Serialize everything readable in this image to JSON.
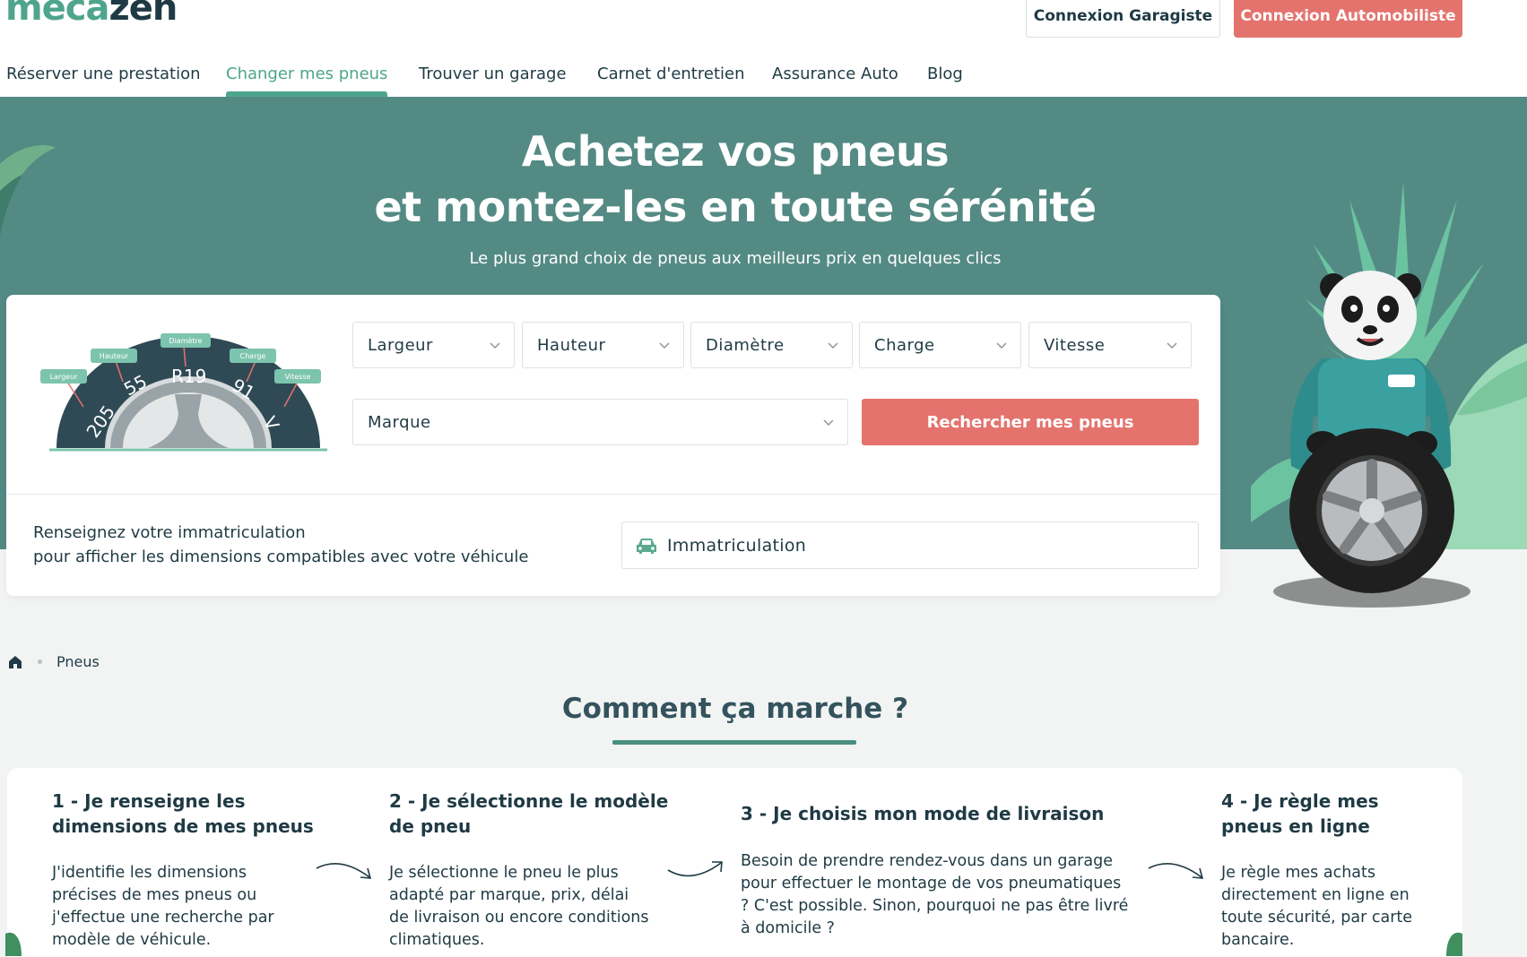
{
  "header": {
    "logo_part1": "meca",
    "logo_part2": "zen",
    "btn_garagiste": "Connexion Garagiste",
    "btn_automobiliste": "Connexion Automobiliste",
    "nav": [
      {
        "label": "Réserver une prestation",
        "active": false
      },
      {
        "label": "Changer mes pneus",
        "active": true
      },
      {
        "label": "Trouver un garage",
        "active": false
      },
      {
        "label": "Carnet d'entretien",
        "active": false
      },
      {
        "label": "Assurance Auto",
        "active": false
      },
      {
        "label": "Blog",
        "active": false
      }
    ]
  },
  "hero": {
    "title_line1": "Achetez vos pneus",
    "title_line2": "et montez-les en toute sérénité",
    "subtitle": "Le plus grand choix de pneus aux meilleurs prix en quelques clics"
  },
  "tire_diagram": {
    "labels": {
      "largeur": "Largeur",
      "hauteur": "Hauteur",
      "diametre": "Diamètre",
      "charge": "Charge",
      "vitesse": "Vitesse"
    },
    "values": {
      "largeur": "205",
      "hauteur": "55",
      "diametre": "R19",
      "charge": "91",
      "vitesse": "V"
    }
  },
  "search": {
    "selects": [
      "Largeur",
      "Hauteur",
      "Diamètre",
      "Charge",
      "Vitesse"
    ],
    "brand_select": "Marque",
    "search_button": "Rechercher mes pneus",
    "plate_text_line1": "Renseignez votre immatriculation",
    "plate_text_line2": "pour afficher les dimensions compatibles avec votre véhicule",
    "plate_placeholder": "Immatriculation"
  },
  "breadcrumb": {
    "current": "Pneus"
  },
  "how": {
    "title": "Comment ça marche ?",
    "steps": [
      {
        "title_line1": "1 - Je renseigne les",
        "title_line2": "dimensions de mes pneus",
        "text": [
          "J'identifie les dimensions",
          "précises de mes pneus ou",
          "j'effectue une recherche par",
          "modèle de véhicule."
        ]
      },
      {
        "title_line1": "2 - Je sélectionne le modèle",
        "title_line2": "de pneu",
        "text": [
          "Je sélectionne le pneu le plus",
          "adapté par marque, prix, délai",
          "de livraison ou encore conditions",
          "climatiques."
        ]
      },
      {
        "title_line1": "3 - Je choisis mon mode de livraison",
        "title_line2": "",
        "text": [
          "Besoin de prendre rendez-vous dans un garage",
          "pour effectuer le montage de vos pneumatiques",
          "? C'est possible. Sinon, pourquoi ne pas être livré",
          "à domicile ?"
        ]
      },
      {
        "title_line1": "4 - Je règle mes",
        "title_line2": "pneus en ligne",
        "text": [
          "Je règle mes achats",
          "directement en ligne en",
          "toute sécurité, par carte",
          "bancaire."
        ]
      }
    ]
  },
  "colors": {
    "brand_green": "#4fa58c",
    "hero_bg": "#548a84",
    "accent_red": "#e4736d",
    "text_dark": "#1f3a44"
  },
  "icons": [
    "chevron-down-icon",
    "car-icon",
    "home-icon",
    "curved-arrow-icon"
  ]
}
